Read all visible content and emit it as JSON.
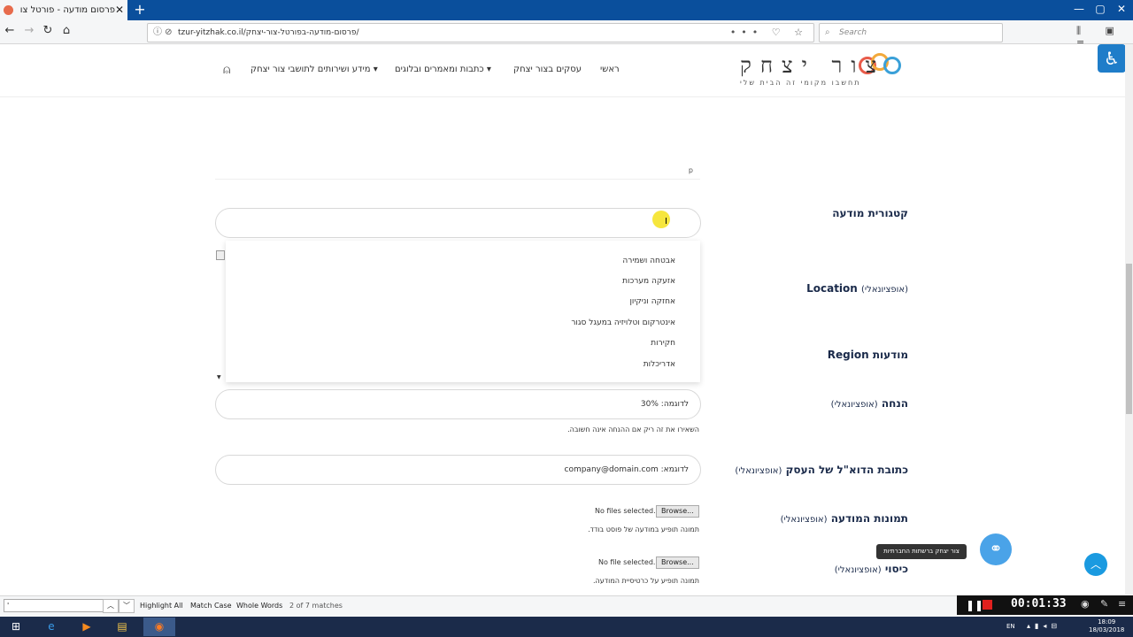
{
  "browser": {
    "tab_title": "פרסום מודעה - פורטל צור יצחק",
    "tab_close": "✕",
    "new_tab": "+",
    "url": "tzur-yitzhak.co.il/פרסום-מודעה-בפורטל-צור-יצחק/",
    "url_actions": "••• ♡ ☆",
    "search_placeholder": "Search",
    "toolbar_icons": "⫼ ▣ ≡"
  },
  "site_nav": {
    "logo_text": "צור יצחק",
    "logo_tagline": "תחשבו מקומי זה הבית שלי",
    "items": [
      "ראשי",
      "עסקים בצור יצחק",
      "כתבות ומאמרים ובלוגים",
      "מידע ושירותים לתושבי צור יצחק"
    ]
  },
  "form": {
    "textarea_status": "p",
    "category_label": "קטגורית מודעה",
    "location_label": "Location",
    "location_opt": "(אופציונאלי)",
    "region_label": "מודעות Region",
    "dropdown_options": [
      "אבטחה ושמירה",
      "אזעקה מערכות",
      "אחזקה וניקיון",
      "אינטרקום וטלויזיה במעגל סגור",
      "חקירות",
      "אדריכלות"
    ],
    "discount_label": "הנחה",
    "discount_opt": "(אופציונאלי)",
    "discount_placeholder": "לדוגמה: 30%",
    "discount_hint": "השאירו את זה ריק אם ההנחה אינה חשובה.",
    "email_label": "כתובת הדוא\"ל של העסק",
    "email_opt": "(אופציונאלי)",
    "email_placeholder": "לדוגמא: company@domain.com",
    "images_label": "תמונות המודעה",
    "images_opt": "(אופציונאלי)",
    "images_status": "No files selected.",
    "browse_label": "Browse...",
    "images_hint": "תמונה תופיע במודעה של פוסט בודד.",
    "cover_label": "כיסוי",
    "cover_opt": "(אופציונאלי)",
    "cover_status": "No file selected.",
    "cover_hint": "תמונה תופיע על כרטיסיית המודעה."
  },
  "floating": {
    "social_tooltip": "צור יצחק ברשתות החברתיות",
    "to_top": "︿"
  },
  "find_bar": {
    "query": "'",
    "highlight_all": "Highlight All",
    "match_case": "Match Case",
    "whole_words": "Whole Words",
    "matches": "2 of 7 matches"
  },
  "recorder": {
    "time": "00:01:33"
  },
  "tray": {
    "lang": "EN",
    "time": "18:09",
    "date": "18/03/2018"
  }
}
